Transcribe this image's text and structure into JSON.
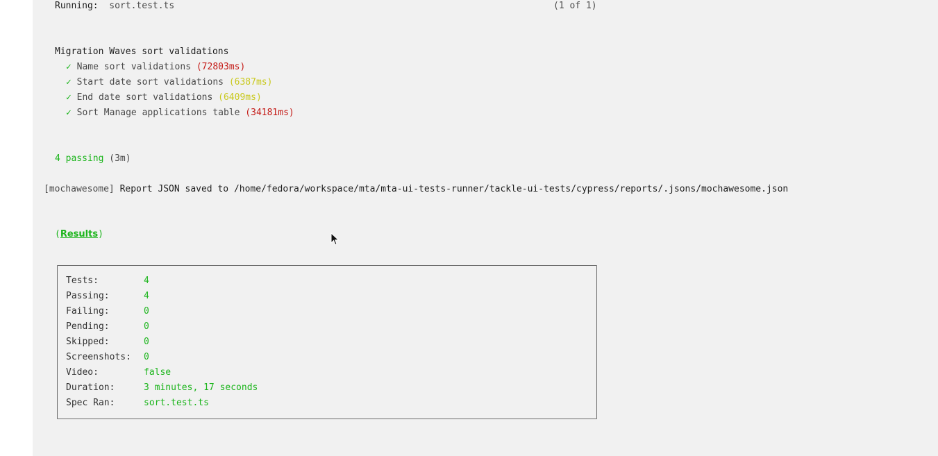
{
  "header": {
    "running_label": "Running:",
    "spec_file": "sort.test.ts",
    "spec_count": "(1 of 1)"
  },
  "suite": {
    "title": "Migration Waves sort validations",
    "check_glyph": "✓",
    "tests": [
      {
        "name": "Name sort validations",
        "duration": "(72803ms)",
        "speed": "slow"
      },
      {
        "name": "Start date sort validations",
        "duration": "(6387ms)",
        "speed": "medium"
      },
      {
        "name": "End date sort validations",
        "duration": "(6409ms)",
        "speed": "medium"
      },
      {
        "name": "Sort Manage applications table",
        "duration": "(34181ms)",
        "speed": "slow"
      }
    ]
  },
  "summary": {
    "passing": "4 passing",
    "time": "(3m)"
  },
  "report": {
    "prefix": "[mochawesome]",
    "message": "Report JSON saved to /home/fedora/workspace/mta/mta-ui-tests-runner/tackle-ui-tests/cypress/reports/.jsons/mochawesome.json"
  },
  "results_heading": {
    "open_paren": "(",
    "label": "Results",
    "close_paren": ")"
  },
  "results": [
    {
      "label": "Tests:",
      "value": "4"
    },
    {
      "label": "Passing:",
      "value": "4"
    },
    {
      "label": "Failing:",
      "value": "0"
    },
    {
      "label": "Pending:",
      "value": "0"
    },
    {
      "label": "Skipped:",
      "value": "0"
    },
    {
      "label": "Screenshots:",
      "value": "0"
    },
    {
      "label": "Video:",
      "value": "false"
    },
    {
      "label": "Duration:",
      "value": "3 minutes, 17 seconds"
    },
    {
      "label": "Spec Ran:",
      "value": "sort.test.ts"
    }
  ],
  "colors": {
    "pass": "#1cb51c",
    "slow": "#c41a16",
    "medium": "#c9c91e",
    "background": "#f1f1f1"
  }
}
